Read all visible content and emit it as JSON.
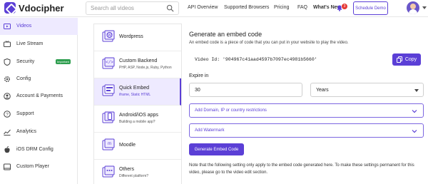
{
  "header": {
    "logo_text": "Vdocipher",
    "search_placeholder": "Search all videos",
    "nav": [
      "API Overview",
      "Supported Browsers",
      "Pricing",
      "FAQ"
    ],
    "whats_new": "What's New",
    "notification_count": "3",
    "schedule_demo": "Schedule Demo"
  },
  "sidebar": {
    "items": [
      {
        "label": "Videos",
        "icon": "video-icon"
      },
      {
        "label": "Live Stream",
        "icon": "live-stream-icon"
      },
      {
        "label": "Security",
        "icon": "shield-icon",
        "badge": "Important"
      },
      {
        "label": "Config",
        "icon": "gear-icon"
      },
      {
        "label": "Account & Payments",
        "icon": "account-icon"
      },
      {
        "label": "Support",
        "icon": "support-icon"
      },
      {
        "label": "Analytics",
        "icon": "analytics-icon"
      },
      {
        "label": "iOS DRM Config",
        "icon": "apple-icon"
      },
      {
        "label": "Custom Player",
        "icon": "player-icon"
      }
    ]
  },
  "options": [
    {
      "title": "Wordpress",
      "subtitle": "",
      "icon": "wordpress-icon"
    },
    {
      "title": "Custom Backend",
      "subtitle": "PHP, ASP, Node.js, Ruby, Python",
      "icon": "code-icon"
    },
    {
      "title": "Quick Embed",
      "subtitle": "iframe, Static HTML",
      "icon": "embed-icon"
    },
    {
      "title": "Android/iOS apps",
      "subtitle": "Building a mobile app?",
      "icon": "mobile-icon"
    },
    {
      "title": "Moodle",
      "subtitle": "",
      "icon": "moodle-icon"
    },
    {
      "title": "Others",
      "subtitle": "Different platform?",
      "icon": "others-icon"
    }
  ],
  "main": {
    "title": "Generate an embed code",
    "description": "An embed code is a piece of code that you can put in your website to play the video.",
    "video_id": "Video Id: '904967c41aad4597b7097ec4981b5660'",
    "copy_label": "Copy",
    "expire_label": "Expire in",
    "expire_value": "30",
    "expire_unit": "Years",
    "restrictions_label": "Add Domain, IP or country restrictions",
    "watermark_label": "Add Watermark",
    "generate_label": "Generate Embed Code",
    "note": "Note that the following setting only apply to the embed code generated here. To make these settings permanent for this video, please go to the video edit section."
  },
  "colors": {
    "accent": "#5b3fd6",
    "active_bg": "#eeeaff",
    "important_badge": "#2e9e4f",
    "notification": "#e53935"
  }
}
